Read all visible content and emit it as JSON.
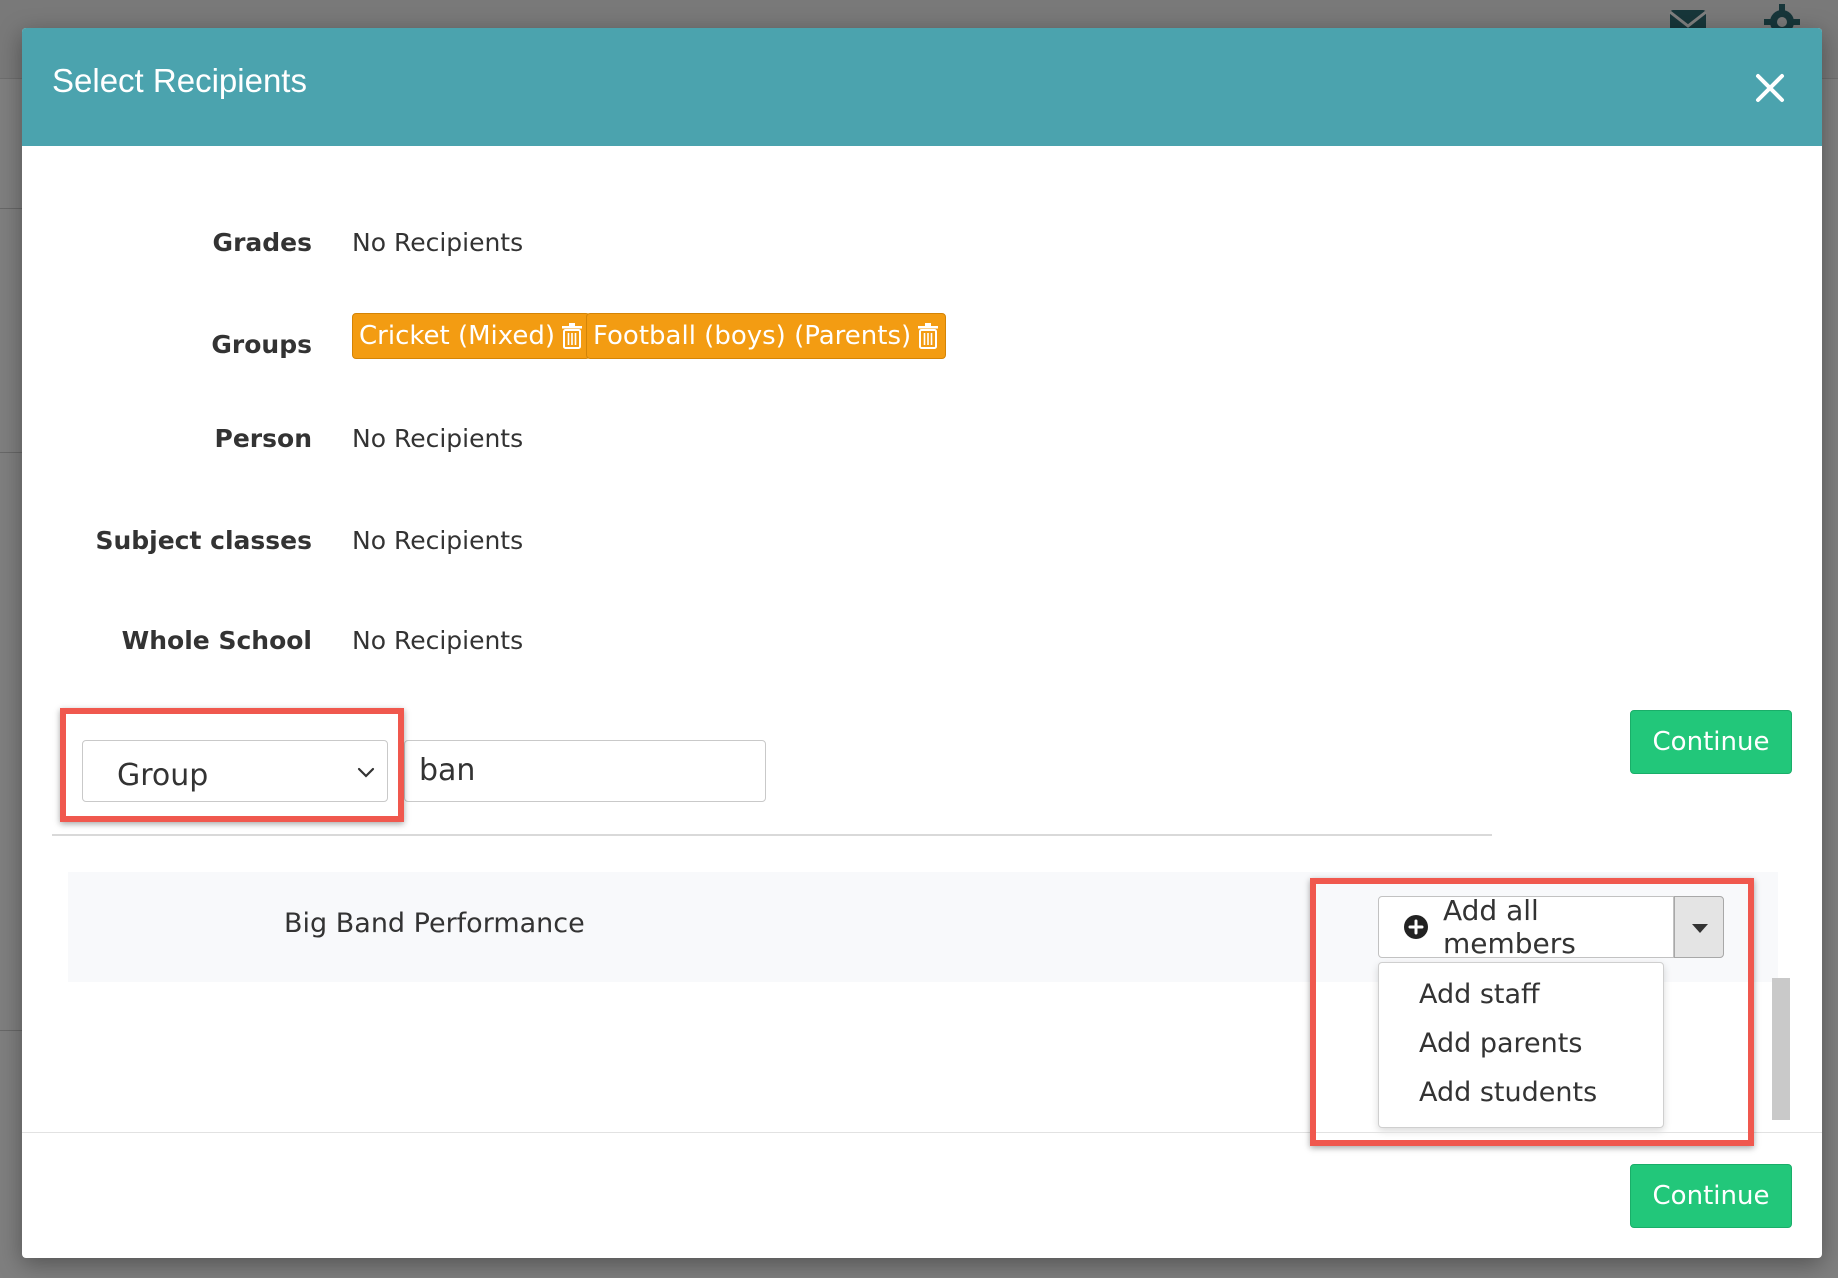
{
  "modal": {
    "title": "Select Recipients",
    "rows": [
      {
        "label": "Grades",
        "value": "No Recipients"
      },
      {
        "label": "Groups"
      },
      {
        "label": "Person",
        "value": "No Recipients"
      },
      {
        "label": "Subject classes",
        "value": "No Recipients"
      },
      {
        "label": "Whole School",
        "value": "No Recipients"
      }
    ],
    "group_tags": [
      "Cricket (Mixed)",
      "Football (boys) (Parents)"
    ],
    "continue_label": "Continue",
    "search": {
      "type_selected": "Group",
      "query": "ban"
    },
    "results": [
      {
        "name": "Big Band Performance",
        "action_label": "Add all members",
        "menu": [
          "Add staff",
          "Add parents",
          "Add students"
        ]
      }
    ]
  },
  "icons": {
    "close": "close-icon",
    "tag_remove": "trash-icon",
    "add": "plus-circle-icon",
    "caret": "caret-down-icon",
    "select": "chevron-down-icon"
  },
  "colors": {
    "header": "#4ba3ae",
    "tag": "#f39c12",
    "continue": "#22c77a",
    "annotation": "#f0584e"
  }
}
